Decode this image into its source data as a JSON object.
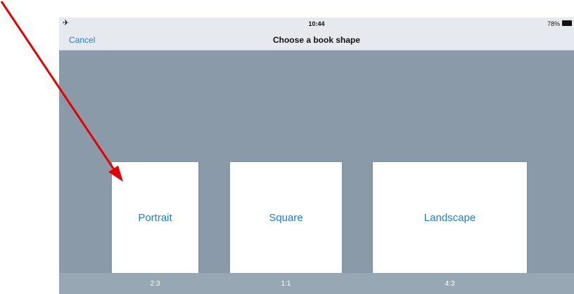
{
  "status_bar": {
    "airplane_icon": "airplane-icon",
    "time": "10:44",
    "battery_percent": "78%",
    "battery_icon": "battery-icon"
  },
  "nav_bar": {
    "cancel_label": "Cancel",
    "title": "Choose a book shape"
  },
  "shapes": [
    {
      "label": "Portrait",
      "ratio": "2:3"
    },
    {
      "label": "Square",
      "ratio": "1:1"
    },
    {
      "label": "Landscape",
      "ratio": "4:3"
    }
  ],
  "colors": {
    "accent": "#1a7ee6",
    "background": "#8a9aa8",
    "bar": "#e6e9ed",
    "annotation_arrow": "#e60000"
  }
}
